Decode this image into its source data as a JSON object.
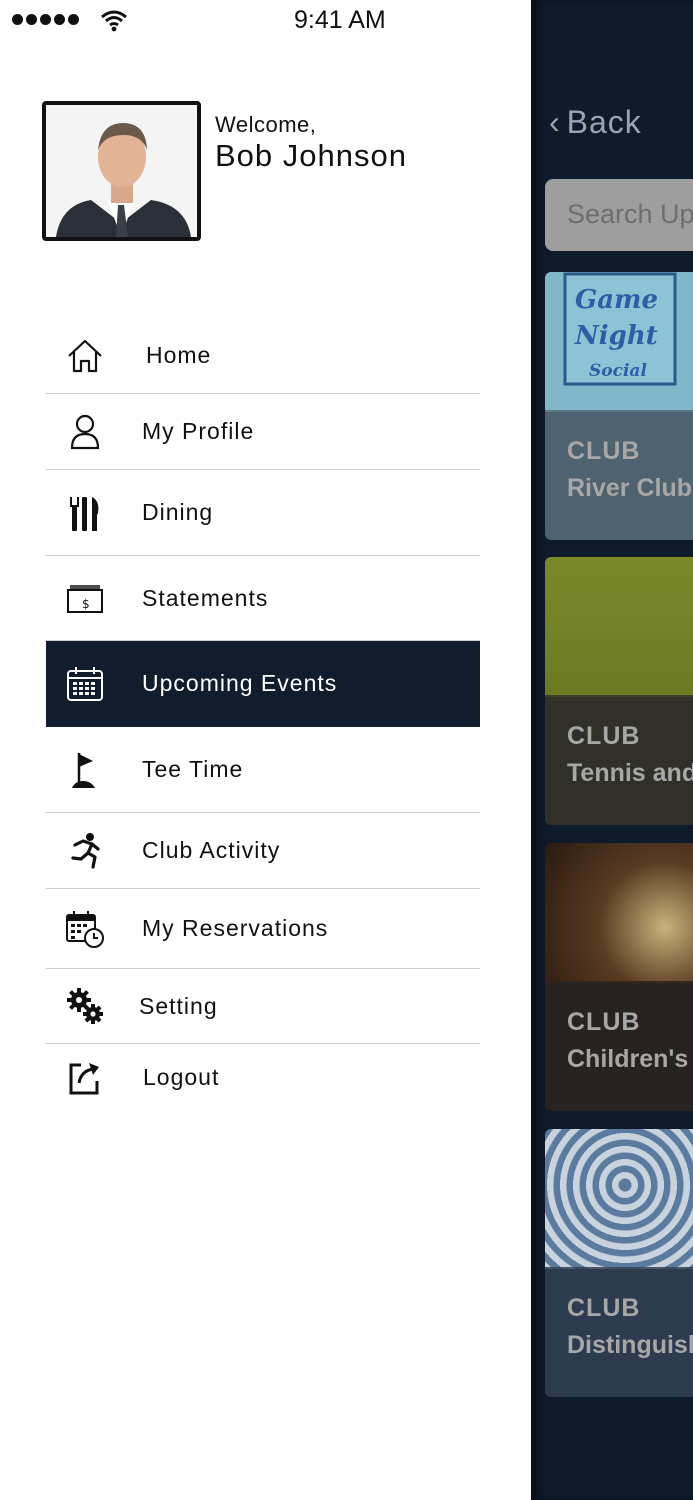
{
  "status_bar": {
    "time": "9:41 AM"
  },
  "profile": {
    "welcome": "Welcome,",
    "name": "Bob Johnson"
  },
  "menu": [
    {
      "label": "Home",
      "icon": "home-icon"
    },
    {
      "label": "My Profile",
      "icon": "user-icon"
    },
    {
      "label": "Dining",
      "icon": "dining-icon"
    },
    {
      "label": "Statements",
      "icon": "statement-icon"
    },
    {
      "label": "Upcoming Events",
      "icon": "calendar-icon",
      "active": true
    },
    {
      "label": "Tee Time",
      "icon": "golf-flag-icon"
    },
    {
      "label": "Club Activity",
      "icon": "running-icon"
    },
    {
      "label": "My Reservations",
      "icon": "calendar-clock-icon"
    },
    {
      "label": "Setting",
      "icon": "gears-icon"
    },
    {
      "label": "Logout",
      "icon": "logout-icon"
    }
  ],
  "background_page": {
    "back_label": "Back",
    "search_placeholder": "Search Up",
    "events": [
      {
        "category": "CLUB",
        "title": "River Club I",
        "image_text": [
          "Game",
          "Night",
          "Social"
        ]
      },
      {
        "category": "CLUB",
        "title": "Tennis and"
      },
      {
        "category": "CLUB",
        "title": "Children's I"
      },
      {
        "category": "CLUB",
        "title": "Distinguisl"
      }
    ]
  },
  "colors": {
    "active_bg": "#0f1d2d",
    "panel_bg": "#0e1b2b"
  }
}
